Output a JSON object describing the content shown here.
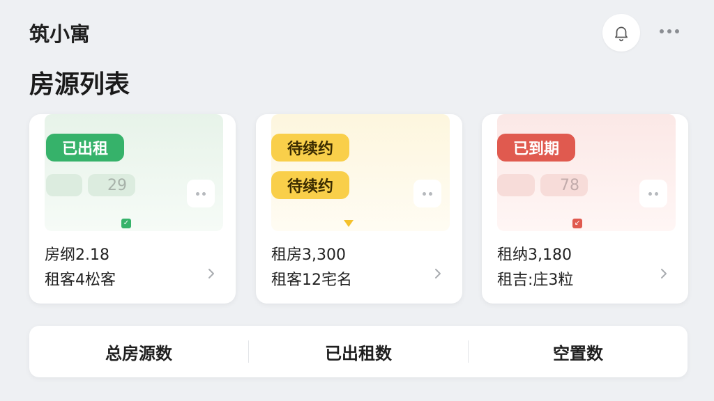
{
  "header": {
    "app_name": "筑小寓",
    "page_title": "房源列表",
    "bell_icon": "bell-icon",
    "more_icon": "more-horizontal-icon"
  },
  "cards": [
    {
      "status": "已出租",
      "status_color": "#36b26a",
      "ghost_number": "29",
      "line1": "房纲2.18",
      "line2": "租客4松客"
    },
    {
      "status": "待续约",
      "status_repeat": "待续约",
      "status_color": "#f9cf4a",
      "line1": "租房3,300",
      "line2": "租客12宅名"
    },
    {
      "status": "已到期",
      "status_color": "#e05a4f",
      "ghost_number": "78",
      "line1": "租纳3,180",
      "line2": "租吉:庄3粒"
    }
  ],
  "stats": {
    "total_label": "总房源数",
    "rented_label": "已出租数",
    "vacant_label": "空置数"
  }
}
